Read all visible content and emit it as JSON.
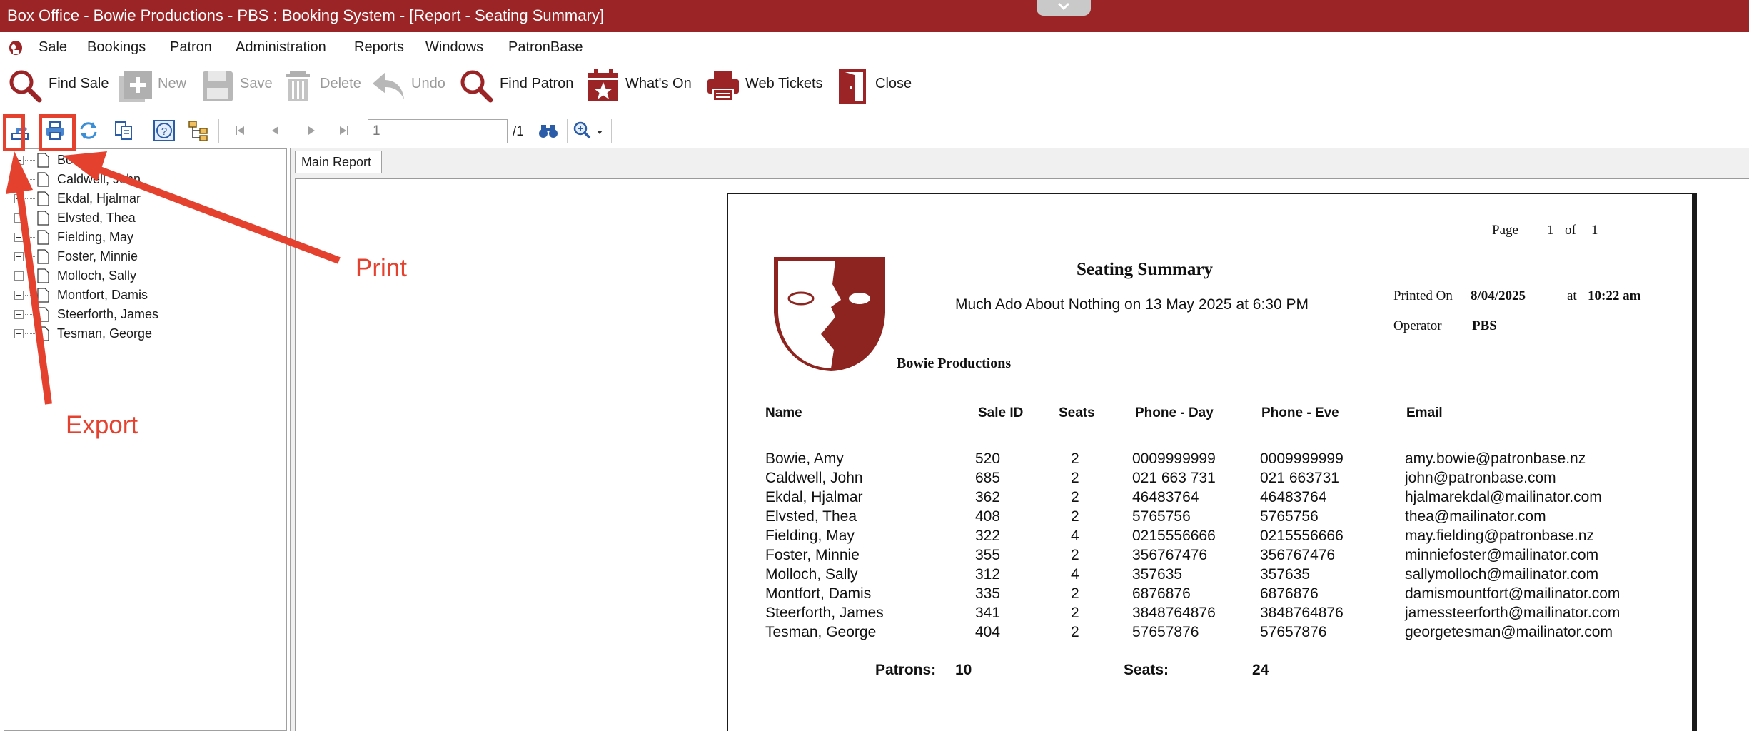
{
  "window": {
    "title": "Box Office - Bowie Productions - PBS : Booking System - [Report - Seating Summary]"
  },
  "menu": [
    "Sale",
    "Bookings",
    "Patron",
    "Administration",
    "Reports",
    "Windows",
    "PatronBase"
  ],
  "toolbar": {
    "find_sale": "Find Sale",
    "new": "New",
    "save": "Save",
    "delete": "Delete",
    "undo": "Undo",
    "find_patron": "Find Patron",
    "whats_on": "What's On",
    "web_tickets": "Web Tickets",
    "close": "Close"
  },
  "viewer": {
    "page_value": "1",
    "page_total": "/1"
  },
  "tree": [
    "Bowie,",
    "Caldwell, John",
    "Ekdal, Hjalmar",
    "Elvsted, Thea",
    "Fielding, May",
    "Foster, Minnie",
    "Molloch, Sally",
    "Montfort, Damis",
    "Steerforth, James",
    "Tesman, George"
  ],
  "tab": "Main Report",
  "report": {
    "page_label": "Page",
    "page_num": "1",
    "page_of": "of",
    "page_total": "1",
    "title": "Seating Summary",
    "subtitle": "Much Ado About Nothing on 13 May 2025 at 6:30 PM",
    "printed_on_label": "Printed On",
    "printed_on_date": "8/04/2025",
    "at_label": "at",
    "printed_time": "10:22 am",
    "operator_label": "Operator",
    "operator": "PBS",
    "company": "Bowie Productions",
    "columns": [
      "Name",
      "Sale ID",
      "Seats",
      "Phone - Day",
      "Phone - Eve",
      "Email"
    ],
    "rows": [
      [
        "Bowie, Amy",
        "520",
        "2",
        "0009999999",
        "0009999999",
        "amy.bowie@patronbase.nz"
      ],
      [
        "Caldwell, John",
        "685",
        "2",
        "021 663 731",
        "021 663731",
        "john@patronbase.com"
      ],
      [
        "Ekdal, Hjalmar",
        "362",
        "2",
        "46483764",
        "46483764",
        "hjalmarekdal@mailinator.com"
      ],
      [
        "Elvsted, Thea",
        "408",
        "2",
        "5765756",
        "5765756",
        "thea@mailinator.com"
      ],
      [
        "Fielding, May",
        "322",
        "4",
        "0215556666",
        "0215556666",
        "may.fielding@patronbase.nz"
      ],
      [
        "Foster, Minnie",
        "355",
        "2",
        "356767476",
        "356767476",
        "minniefoster@mailinator.com"
      ],
      [
        "Molloch, Sally",
        "312",
        "4",
        "357635",
        "357635",
        "sallymolloch@mailinator.com"
      ],
      [
        "Montfort, Damis",
        "335",
        "2",
        "6876876",
        "6876876",
        "damismountfort@mailinator.com"
      ],
      [
        "Steerforth, James",
        "341",
        "2",
        "3848764876",
        "3848764876",
        "jamessteerforth@mailinator.com"
      ],
      [
        "Tesman, George",
        "404",
        "2",
        "57657876",
        "57657876",
        "georgetesman@mailinator.com"
      ]
    ],
    "patrons_label": "Patrons:",
    "patrons_value": "10",
    "seats_label": "Seats:",
    "seats_value": "24"
  },
  "annotations": {
    "print": "Print",
    "export": "Export",
    "color": "#e5412f"
  },
  "colors": {
    "titlebar": "#9b2426",
    "accent": "#9b2426"
  }
}
